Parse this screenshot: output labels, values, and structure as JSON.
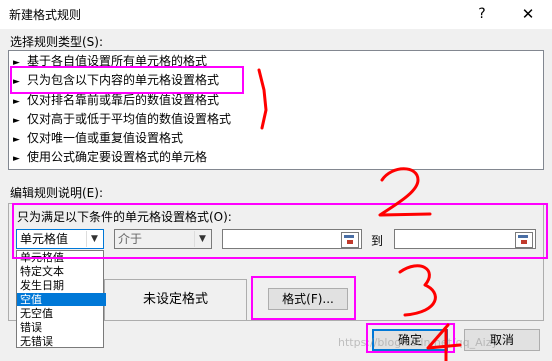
{
  "window": {
    "title": "新建格式规则",
    "help_glyph": "?",
    "close_glyph": "✕"
  },
  "rule_type": {
    "label": "选择规则类型(S):",
    "items": [
      "基于各自值设置所有单元格的格式",
      "只为包含以下内容的单元格设置格式",
      "仅对排名靠前或靠后的数值设置格式",
      "仅对高于或低于平均值的数值设置格式",
      "仅对唯一值或重复值设置格式",
      "使用公式确定要设置格式的单元格"
    ],
    "selected_index": 1
  },
  "description": {
    "label": "编辑规则说明(E):",
    "condition_label": "只为满足以下条件的单元格设置格式(O):",
    "combo1_value": "单元格值",
    "combo2_value": "介于",
    "and_label": "到",
    "dropdown_options": [
      "单元格值",
      "特定文本",
      "发生日期",
      "空值",
      "无空值",
      "错误",
      "无错误"
    ],
    "dropdown_highlighted_index": 3,
    "preview_text": "未设定格式",
    "format_button": "格式(F)..."
  },
  "buttons": {
    "ok": "确定",
    "cancel": "取消"
  },
  "annotations": [
    "1",
    "2",
    "3",
    "4"
  ],
  "watermark": "https://blog.csdn.net/qq_Aizy",
  "colors": {
    "highlight": "#ff00ff",
    "annotation": "#ff0000",
    "selection": "#0078d7"
  }
}
